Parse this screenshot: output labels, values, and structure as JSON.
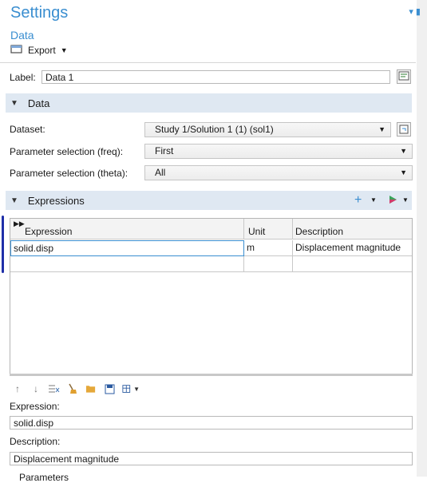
{
  "header": {
    "title": "Settings",
    "subtitle": "Data",
    "export_label": "Export"
  },
  "label_row": {
    "label": "Label:",
    "value": "Data 1"
  },
  "data_section": {
    "title": "Data",
    "dataset": {
      "label": "Dataset:",
      "value": "Study 1/Solution 1 (1) (sol1)"
    },
    "param_freq": {
      "label": "Parameter selection (freq):",
      "value": "First"
    },
    "param_theta": {
      "label": "Parameter selection (theta):",
      "value": "All"
    }
  },
  "expressions_section": {
    "title": "Expressions",
    "columns": [
      "Expression",
      "Unit",
      "Description"
    ],
    "rows": [
      {
        "expression": "solid.disp",
        "unit": "m",
        "description": "Displacement magnitude"
      }
    ]
  },
  "editor": {
    "expression_label": "Expression:",
    "expression_value": "solid.disp",
    "description_label": "Description:",
    "description_value": "Displacement magnitude",
    "parameters_label": "Parameters"
  },
  "colors": {
    "accent": "#3a8ed0",
    "section_bg": "#dfe8f2"
  }
}
